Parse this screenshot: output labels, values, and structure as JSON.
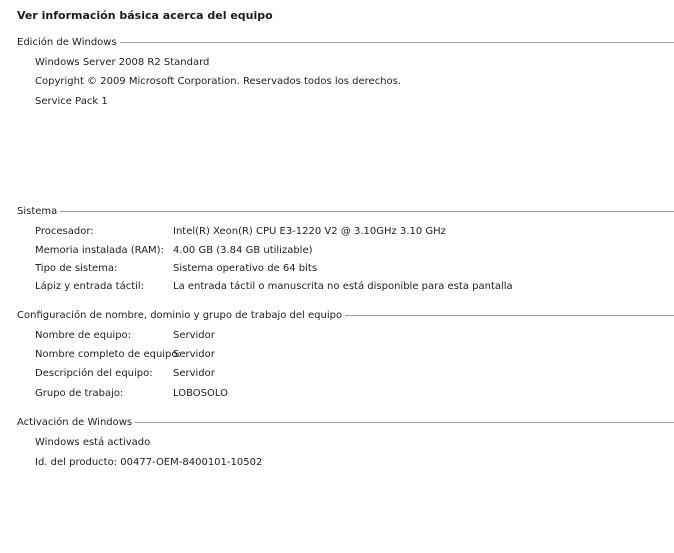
{
  "page": {
    "title": "Ver información básica acerca del equipo"
  },
  "edition": {
    "header": "Edición de Windows",
    "name": "Windows Server 2008 R2 Standard",
    "copyright": "Copyright © 2009 Microsoft Corporation. Reservados todos los derechos.",
    "service_pack": "Service Pack 1"
  },
  "system": {
    "header": "Sistema",
    "rows": [
      {
        "label": "Procesador:",
        "value": "Intel(R) Xeon(R) CPU E3-1220 V2 @ 3.10GHz   3.10 GHz"
      },
      {
        "label": "Memoria instalada (RAM):",
        "value": "4.00 GB (3.84 GB utilizable)"
      },
      {
        "label": "Tipo de sistema:",
        "value": "Sistema operativo de 64 bits"
      },
      {
        "label": "Lápiz y entrada táctil:",
        "value": "La entrada táctil o manuscrita no está disponible para esta pantalla"
      }
    ]
  },
  "computer_name": {
    "header": "Configuración de nombre, dominio y grupo de trabajo del equipo",
    "rows": [
      {
        "label": "Nombre de equipo:",
        "value": "Servidor"
      },
      {
        "label": "Nombre completo de equipo:",
        "value": "Servidor"
      },
      {
        "label": "Descripción del equipo:",
        "value": "Servidor"
      },
      {
        "label": "Grupo de trabajo:",
        "value": "LOBOSOLO"
      }
    ]
  },
  "activation": {
    "header": "Activación de Windows",
    "status": "Windows está activado",
    "product_id": "Id. del producto:  00477-OEM-8400101-10502"
  }
}
